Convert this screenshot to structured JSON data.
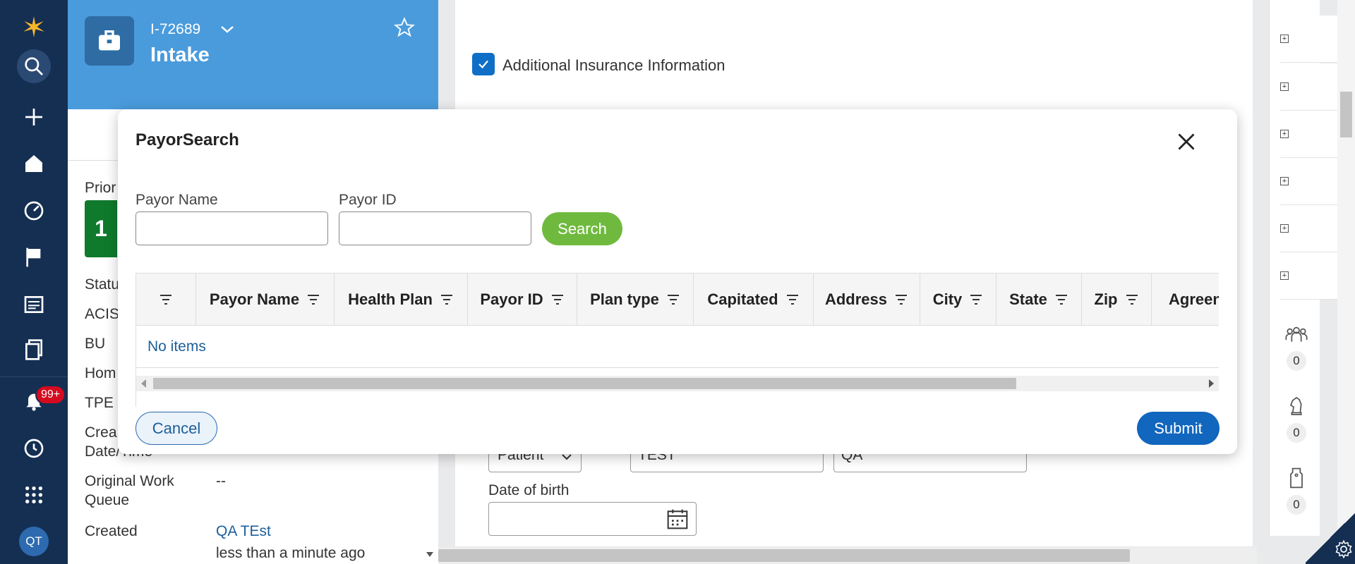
{
  "case": {
    "id": "I-72689",
    "title": "Intake"
  },
  "left_nav": {
    "notification_count": "99+",
    "avatar_initials": "QT"
  },
  "left_panel": {
    "fields": [
      {
        "label": "Prior",
        "value": "1"
      },
      {
        "label": "Statu",
        "value": ""
      },
      {
        "label": "ACIS",
        "value": ""
      },
      {
        "label": "BU",
        "value": ""
      },
      {
        "label": "Hom",
        "value": ""
      },
      {
        "label": "TPE",
        "value": ""
      },
      {
        "label": "Crea",
        "value": ""
      },
      {
        "label": "Date/Time",
        "value": ""
      },
      {
        "label": "Original Work",
        "value": "--"
      },
      {
        "label": "Queue",
        "value": ""
      },
      {
        "label": "Created",
        "value": "QA TEst"
      },
      {
        "label": "",
        "value": "less than a minute ago"
      }
    ]
  },
  "main": {
    "checkbox_label": "Additional Insurance Information",
    "behind_select_value": "Patient",
    "behind_first_name": "TEST",
    "behind_last_name": "QA",
    "dob_label": "Date of birth"
  },
  "right_panel": {
    "counts": [
      "0",
      "0",
      "0"
    ]
  },
  "modal": {
    "title": "PayorSearch",
    "payor_name_label": "Payor Name",
    "payor_id_label": "Payor ID",
    "payor_name_value": "",
    "payor_id_value": "",
    "search_label": "Search",
    "columns": [
      "",
      "Payor Name",
      "Health Plan",
      "Payor ID",
      "Plan type",
      "Capitated",
      "Address",
      "City",
      "State",
      "Zip",
      "Agreen"
    ],
    "empty_text": "No items",
    "cancel_label": "Cancel",
    "submit_label": "Submit"
  }
}
